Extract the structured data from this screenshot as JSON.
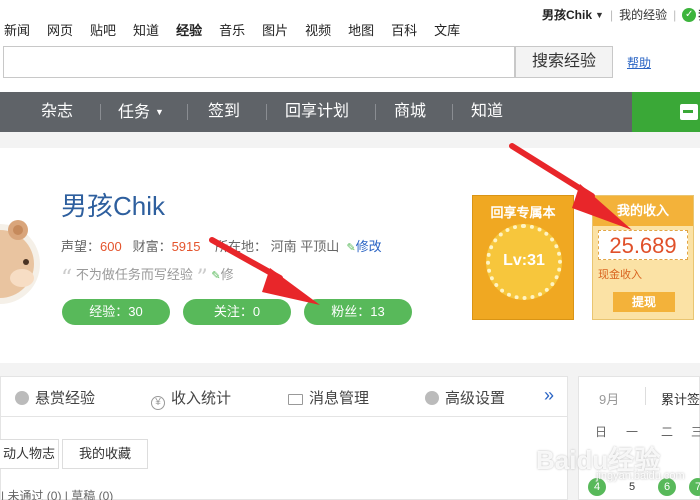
{
  "topnav": {
    "links": [
      "新闻",
      "网页",
      "贴吧",
      "知道",
      "经验",
      "音乐",
      "图片",
      "视频",
      "地图",
      "百科",
      "文库"
    ],
    "active": "经验",
    "username": "男孩Chik",
    "my_experience": "我的经验",
    "extra": "我"
  },
  "search": {
    "value": "",
    "button": "搜索经验",
    "help": "帮助"
  },
  "menubar": {
    "items": [
      "杂志",
      "任务",
      "签到",
      "回享计划",
      "商城",
      "知道"
    ]
  },
  "profile": {
    "name": "男孩Chik",
    "reputation_label": "声望：",
    "reputation": "600",
    "wealth_label": "财富：",
    "wealth": "5915",
    "location_label": "所在地：",
    "location": "河南 平顶山",
    "edit": "修改",
    "motto": "不为做任务而写经验",
    "motto_edit": "修",
    "pills": {
      "experience": "经验：30",
      "following": "关注：0",
      "fans": "粉丝：13"
    }
  },
  "goldcard": {
    "title": "回享专属本",
    "level": "Lv:31"
  },
  "income": {
    "title": "我的收入",
    "amount": "25.689",
    "label": "现金收入",
    "withdraw": "提现"
  },
  "tabs": {
    "items": [
      "悬赏经验",
      "收入统计",
      "消息管理",
      "高级设置"
    ],
    "more": "»",
    "sub": [
      "动人物志",
      "我的收藏"
    ],
    "bottom": "| 未通过 (0)  |  草稿 (0)"
  },
  "calendar": {
    "month": "9月",
    "cumulative": "累计签",
    "weekdays": [
      "日",
      "一",
      "二",
      "三"
    ],
    "days": [
      "4",
      "5",
      "6",
      "7"
    ]
  },
  "watermark": {
    "text": "Baidu经验",
    "sub": "jingyan.baidu.com"
  },
  "colors": {
    "menubar": "#5f6368",
    "green": "#58b95a",
    "gold": "#f0a822",
    "link": "#2a64c4",
    "accent_red": "#e0502a"
  }
}
